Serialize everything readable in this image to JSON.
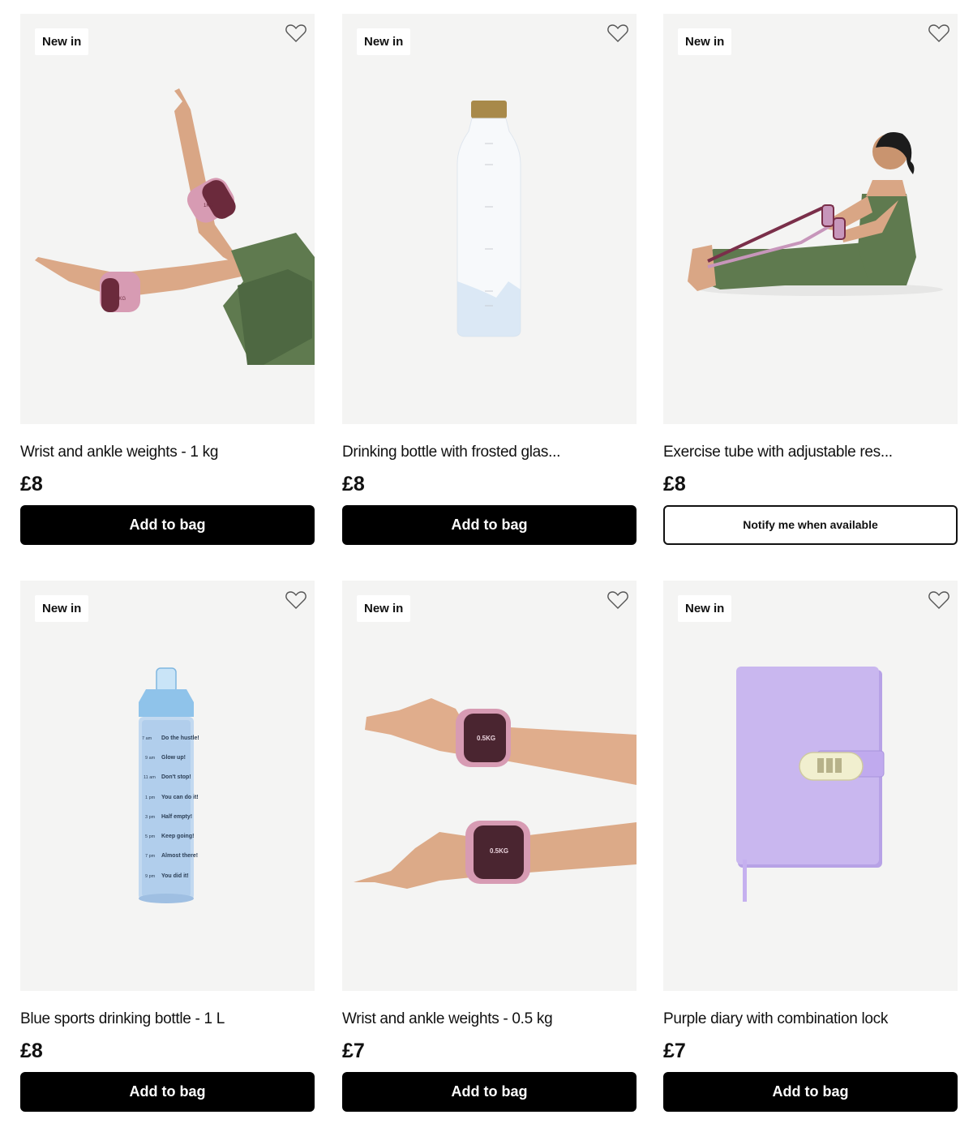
{
  "products": [
    {
      "badge": "New in",
      "title": "Wrist and ankle weights - 1 kg",
      "price": "£8",
      "button": "Add to bag",
      "image_labels": [
        "1KG",
        "1KG"
      ]
    },
    {
      "badge": "New in",
      "title": "Drinking bottle with frosted glas...",
      "price": "£8",
      "button": "Add to bag"
    },
    {
      "badge": "New in",
      "title": "Exercise tube with adjustable res...",
      "price": "£8",
      "button": "Notify me when available"
    },
    {
      "badge": "New in",
      "title": "Blue sports drinking bottle - 1 L",
      "price": "£8",
      "button": "Add to bag",
      "bottle_times": [
        "7 am",
        "9 am",
        "11 am",
        "1 pm",
        "3 pm",
        "5 pm",
        "7 pm",
        "9 pm"
      ],
      "bottle_messages": [
        "Do the hustle!",
        "Glow up!",
        "Don't stop!",
        "You can do it!",
        "Half empty!",
        "Keep going!",
        "Almost there!",
        "You did it!"
      ]
    },
    {
      "badge": "New in",
      "title": "Wrist and ankle weights - 0.5 kg",
      "price": "£7",
      "button": "Add to bag",
      "image_labels": [
        "0.5KG",
        "0.5KG"
      ]
    },
    {
      "badge": "New in",
      "title": "Purple diary with combination lock",
      "price": "£7",
      "button": "Add to bag"
    }
  ],
  "colors": {
    "image_bg": "#f4f4f3",
    "button_dark": "#000000",
    "leggings": "#5f7a4f",
    "weight_pink": "#d79bb3",
    "weight_maroon": "#6b2a3c",
    "bottle_blue": "#8fc3ea",
    "diary_lilac": "#c9b7ef"
  },
  "icons": {
    "favourite": "heart-outline-icon"
  }
}
